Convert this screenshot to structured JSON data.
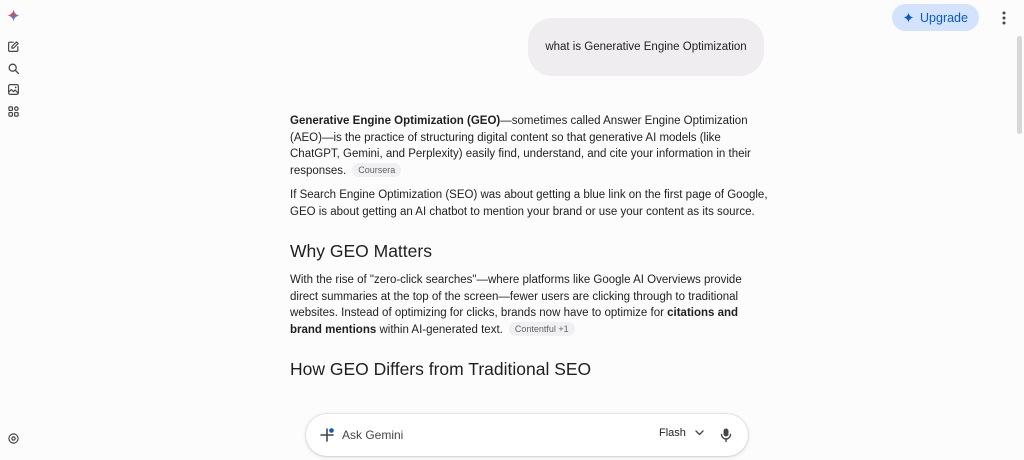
{
  "header": {
    "upgrade_label": "Upgrade"
  },
  "sidebar": {
    "icons": [
      "gemini-logo-icon",
      "new-chat-icon",
      "search-icon",
      "gallery-icon",
      "apps-icon",
      "settings-icon"
    ]
  },
  "user_prompt": "what is Generative Engine Optimization",
  "response": {
    "p1_bold": "Generative Engine Optimization (GEO)",
    "p1_rest": "—sometimes called Answer Engine Optimization (AEO)—is the practice of structuring digital content so that generative AI models (like ChatGPT, Gemini, and Perplexity) easily find, understand, and cite your information in their responses.",
    "p1_source": "Coursera",
    "p2": "If Search Engine Optimization (SEO) was about getting a blue link on the first page of Google, GEO is about getting an AI chatbot to mention your brand or use your content as its source.",
    "h_why": "Why GEO Matters",
    "p3_a": "With the rise of \"zero-click searches\"—where platforms like Google AI Overviews provide direct summaries at the top of the screen—fewer users are clicking through to traditional websites. Instead of optimizing for clicks, brands now have to optimize for ",
    "p3_bold": "citations and brand mentions",
    "p3_b": " within AI-generated text.",
    "p3_source": "Contentful +1",
    "h_how": "How GEO Differs from Traditional SEO"
  },
  "input": {
    "placeholder": "Ask Gemini",
    "model": "Flash"
  },
  "colors": {
    "accent": "#0b57d0",
    "upgrade_bg": "#d3e3fd",
    "bubble_bg": "#f0edf1"
  }
}
